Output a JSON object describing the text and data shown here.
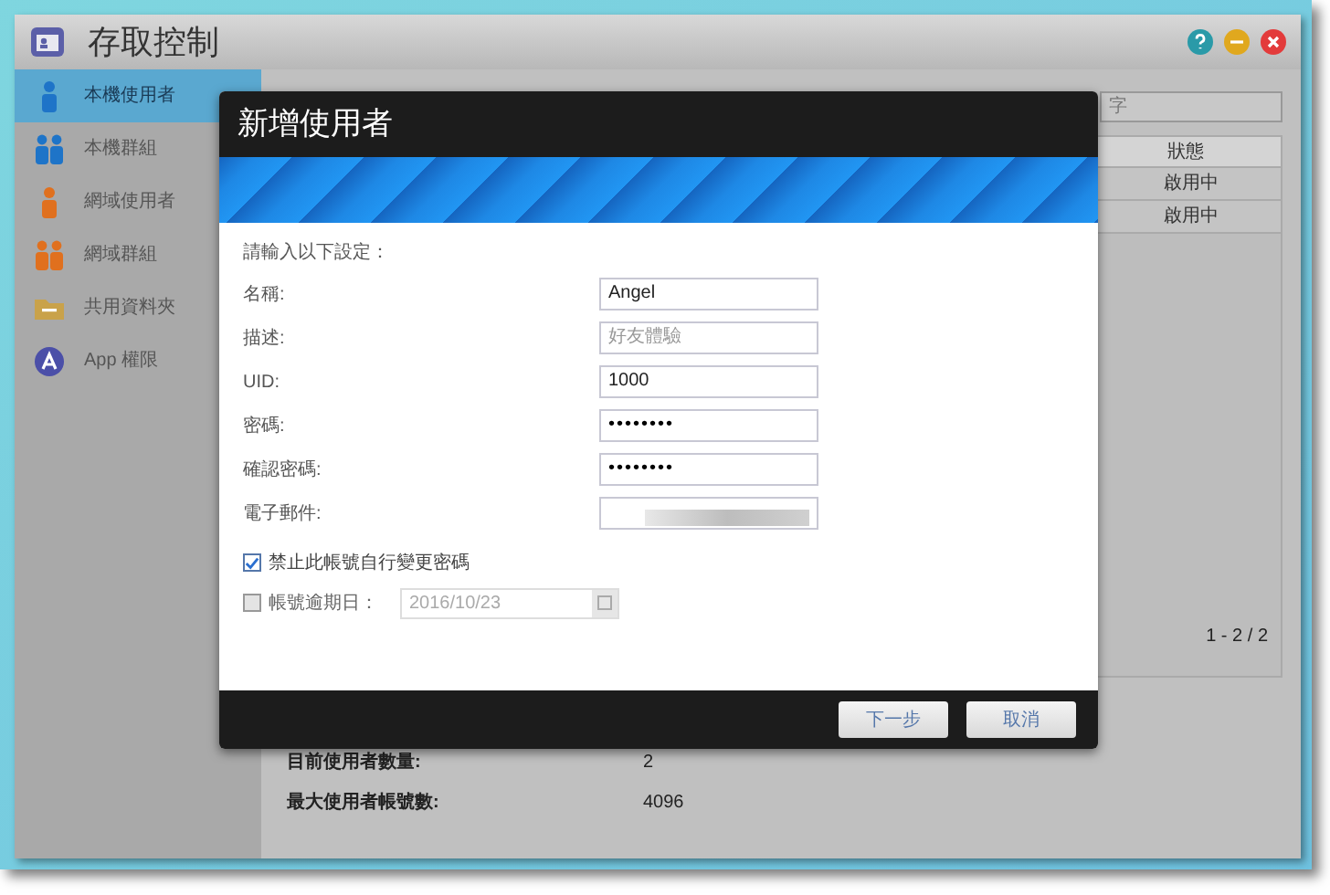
{
  "window": {
    "title": "存取控制"
  },
  "sidebar": {
    "items": [
      {
        "label": "本機使用者",
        "kind": "user",
        "selected": true
      },
      {
        "label": "本機群組",
        "kind": "group",
        "selected": false
      },
      {
        "label": "網域使用者",
        "kind": "domain-user",
        "selected": false
      },
      {
        "label": "網域群組",
        "kind": "domain-group",
        "selected": false
      },
      {
        "label": "共用資料夾",
        "kind": "folder",
        "selected": false
      },
      {
        "label": "App 權限",
        "kind": "app",
        "selected": false
      }
    ]
  },
  "search": {
    "placeholder": "字"
  },
  "table": {
    "columns": [
      "狀態"
    ],
    "rows": [
      [
        "啟用中"
      ],
      [
        "啟用中"
      ]
    ]
  },
  "pagination": "1 - 2 / 2",
  "stats": [
    {
      "label": "目前使用者數量:",
      "value": "2"
    },
    {
      "label": "最大使用者帳號數:",
      "value": "4096"
    }
  ],
  "dialog": {
    "title": "新增使用者",
    "intro": "請輸入以下設定：",
    "fields": [
      {
        "label": "名稱:",
        "kind": "text",
        "value": "Angel"
      },
      {
        "label": "描述:",
        "kind": "text",
        "placeholder": "好友體驗"
      },
      {
        "label": "UID:",
        "kind": "text",
        "value": "1000"
      },
      {
        "label": "密碼:",
        "kind": "password",
        "value": "••••••••"
      },
      {
        "label": "確認密碼:",
        "kind": "password",
        "value": "••••••••"
      },
      {
        "label": "電子郵件:",
        "kind": "redacted"
      }
    ],
    "options": [
      {
        "label": "禁止此帳號自行變更密碼",
        "checked": true
      },
      {
        "label": "帳號逾期日：",
        "checked": false,
        "date": "2016/10/23"
      }
    ],
    "buttons": [
      "下一步",
      "取消"
    ]
  }
}
